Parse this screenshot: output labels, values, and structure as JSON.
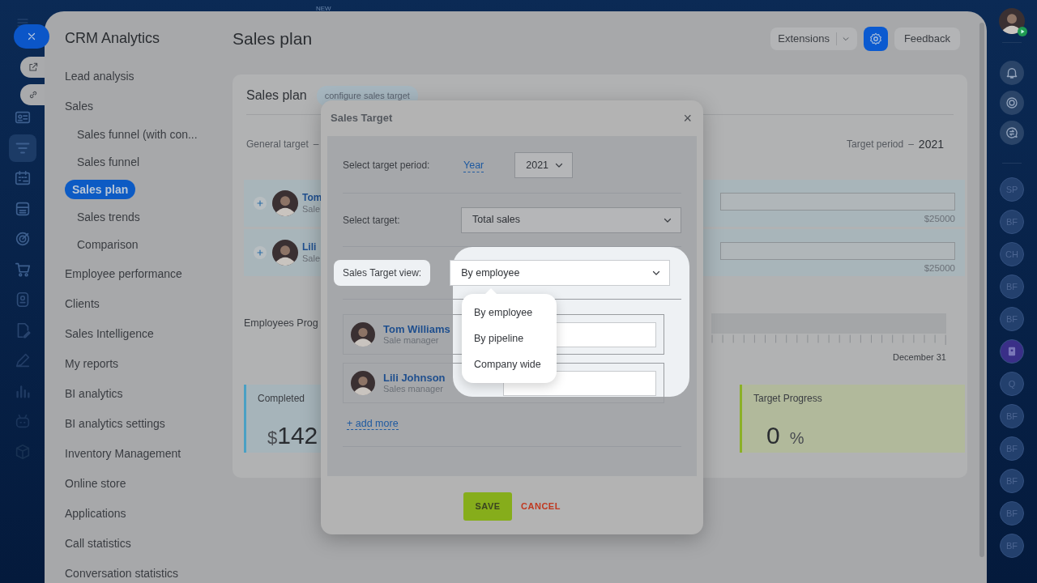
{
  "top_badge": "NEW",
  "sidebar": {
    "title": "CRM Analytics",
    "items": [
      {
        "label": "Lead analysis",
        "selected": false
      },
      {
        "label": "Sales",
        "selected": false,
        "children": [
          {
            "label": "Sales funnel (with con...",
            "selected": false
          },
          {
            "label": "Sales funnel",
            "selected": false
          },
          {
            "label": "Sales plan",
            "selected": true
          },
          {
            "label": "Sales trends",
            "selected": false
          },
          {
            "label": "Comparison",
            "selected": false
          }
        ]
      },
      {
        "label": "Employee performance",
        "selected": false
      },
      {
        "label": "Clients",
        "selected": false
      },
      {
        "label": "Sales Intelligence",
        "selected": false
      },
      {
        "label": "My reports",
        "selected": false
      },
      {
        "label": "BI analytics",
        "selected": false
      },
      {
        "label": "BI analytics settings",
        "selected": false
      },
      {
        "label": "Inventory Management",
        "selected": false
      },
      {
        "label": "Online store",
        "selected": false
      },
      {
        "label": "Applications",
        "selected": false
      },
      {
        "label": "Call statistics",
        "selected": false
      },
      {
        "label": "Conversation statistics",
        "selected": false
      }
    ]
  },
  "header": {
    "title": "Sales plan",
    "extensions": "Extensions",
    "feedback": "Feedback"
  },
  "plan_card": {
    "title": "Sales plan",
    "tag": "configure sales target",
    "general_target": "General target",
    "general_dash": "–",
    "period_label": "Target period",
    "period_dash": "–",
    "period_value": "2021",
    "employees": [
      {
        "name": "Tom",
        "role": "Sale",
        "amount": "$25000"
      },
      {
        "name": "Lili",
        "role": "Sale",
        "amount": "$25000"
      }
    ],
    "progress_label": "Employees Prog",
    "end_date": "December 31",
    "stats": [
      {
        "kind": "money",
        "label": "Completed",
        "currency": "$",
        "value": "142"
      },
      {
        "kind": "percent",
        "label": "Target Progress",
        "value": "0",
        "unit": "%"
      }
    ]
  },
  "modal": {
    "title": "Sales Target",
    "close": "×",
    "fields": [
      {
        "kind": "period",
        "label": "Select target period:",
        "link": "Year",
        "value": "2021",
        "highlighted": false
      },
      {
        "kind": "select",
        "label": "Select target:",
        "value": "Total sales",
        "highlighted": false
      },
      {
        "kind": "select",
        "label": "Sales Target view:",
        "value": "By employee",
        "highlighted": true
      }
    ],
    "dropdown": [
      {
        "label": "By employee"
      },
      {
        "label": "By pipeline"
      },
      {
        "label": "Company wide"
      }
    ],
    "employees": [
      {
        "name": "Tom Williams",
        "role": "Sale manager"
      },
      {
        "name": "Lili Johnson",
        "role": "Sales manager"
      }
    ],
    "add_more": "+ add more",
    "save": "SAVE",
    "cancel": "CANCEL"
  },
  "right_rail": {
    "chats": [
      {
        "kind": "initials",
        "text": "SP"
      },
      {
        "kind": "initials",
        "text": "BF"
      },
      {
        "kind": "initials",
        "text": "CH"
      },
      {
        "kind": "initials",
        "text": "BF"
      },
      {
        "kind": "initials",
        "text": "BF"
      },
      {
        "kind": "book"
      },
      {
        "kind": "initials",
        "text": "Q"
      },
      {
        "kind": "initials",
        "text": "BF"
      },
      {
        "kind": "initials",
        "text": "BF"
      },
      {
        "kind": "initials",
        "text": "BF"
      },
      {
        "kind": "initials",
        "text": "BF"
      },
      {
        "kind": "initials",
        "text": "BF"
      }
    ]
  }
}
